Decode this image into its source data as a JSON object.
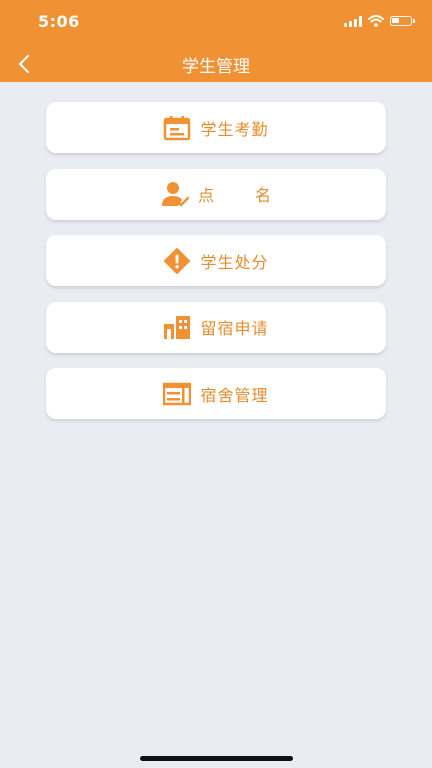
{
  "status_bar": {
    "time": "5:06"
  },
  "nav": {
    "title": "学生管理"
  },
  "colors": {
    "accent": "#f09234",
    "text_accent": "#e58c2f",
    "background": "#e9ecf3"
  },
  "menu": {
    "items": [
      {
        "label": "学生考勤",
        "icon": "calendar-icon"
      },
      {
        "label": "点 名",
        "icon": "user-check-icon"
      },
      {
        "label": "学生处分",
        "icon": "warning-diamond-icon"
      },
      {
        "label": "留宿申请",
        "icon": "building-icon"
      },
      {
        "label": "宿舍管理",
        "icon": "bunk-bed-icon"
      }
    ]
  }
}
